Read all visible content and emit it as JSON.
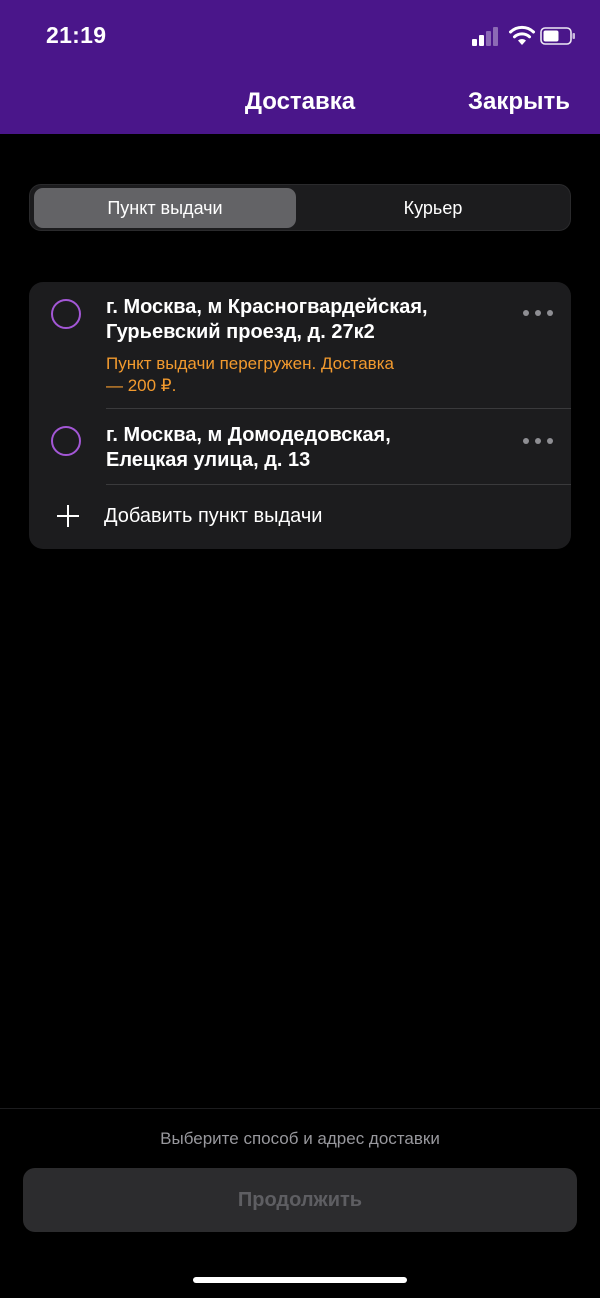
{
  "status_bar": {
    "time": "21:19",
    "icons": [
      "signal-icon",
      "wifi-icon",
      "battery-icon"
    ]
  },
  "nav": {
    "title": "Доставка",
    "close_label": "Закрыть"
  },
  "segmented": {
    "options": [
      {
        "label": "Пункт выдачи",
        "selected": true
      },
      {
        "label": "Курьер",
        "selected": false
      }
    ]
  },
  "pickup_points": [
    {
      "address_line1": "г. Москва, м Красногвардейская,",
      "address_line2": "Гурьевский проезд, д. 27к2",
      "warning_line1": "Пункт выдачи перегружен. Доставка",
      "warning_line2": "— 200 ₽.",
      "selected": false
    },
    {
      "address_line1": "г. Москва, м Домодедовская,",
      "address_line2": "Елецкая улица, д. 13",
      "selected": false
    }
  ],
  "add_pickup_label": "Добавить пункт выдачи",
  "footer": {
    "hint": "Выберите способ и адрес доставки",
    "continue_label": "Продолжить",
    "continue_enabled": false
  },
  "colors": {
    "header_bg": "#4a168a",
    "accent_radio": "#a357d6",
    "warning": "#f29a2e",
    "card_bg": "#1c1c1e"
  }
}
